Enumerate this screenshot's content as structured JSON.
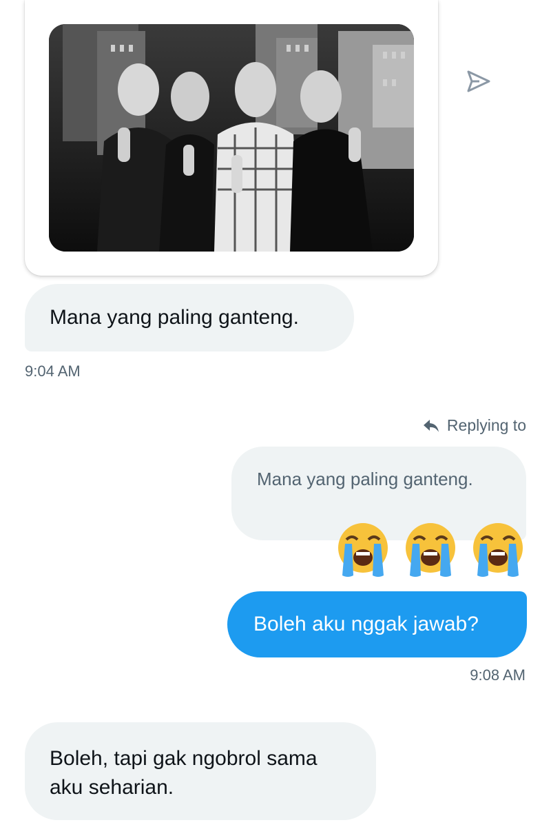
{
  "media": {
    "photo_subject": "photo-four-people"
  },
  "messages": {
    "first": {
      "text": "Mana yang paling ganteng.",
      "time": "9:04 AM"
    },
    "reply": {
      "label": "Replying to",
      "quoted_text": "Mana yang paling ganteng.",
      "reactions": [
        "loudly-crying-face",
        "loudly-crying-face",
        "loudly-crying-face"
      ],
      "text": "Boleh aku nggak jawab?",
      "time": "9:08 AM"
    },
    "last": {
      "text": "Boleh, tapi gak ngobrol sama aku seharian."
    }
  },
  "colors": {
    "accent": "#1d9bf0",
    "bubble_gray": "#eff3f4",
    "muted_text": "#536471"
  }
}
